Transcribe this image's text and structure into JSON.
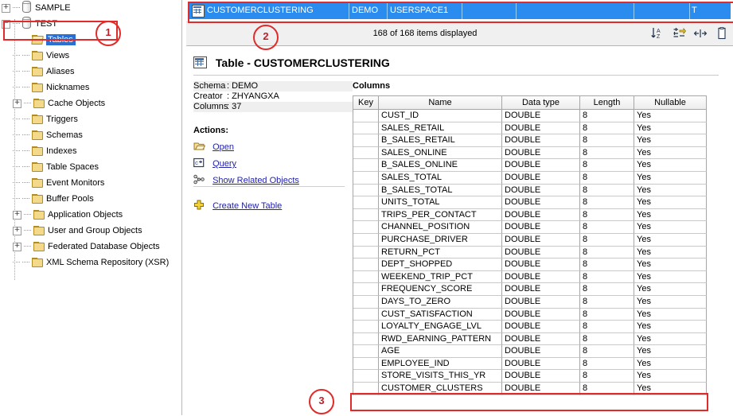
{
  "tree": {
    "items": [
      {
        "label": "SAMPLE",
        "icon": "database-icon",
        "level": 0,
        "expander": "plus",
        "selected": false
      },
      {
        "label": "TEST",
        "icon": "database-icon",
        "level": 0,
        "expander": "minus",
        "selected": false
      },
      {
        "label": "Tables",
        "icon": "folder-open-icon",
        "level": 1,
        "expander": "none",
        "selected": true
      },
      {
        "label": "Views",
        "icon": "folder-icon",
        "level": 1,
        "expander": "none",
        "selected": false
      },
      {
        "label": "Aliases",
        "icon": "folder-icon",
        "level": 1,
        "expander": "none",
        "selected": false
      },
      {
        "label": "Nicknames",
        "icon": "folder-icon",
        "level": 1,
        "expander": "none",
        "selected": false
      },
      {
        "label": "Cache Objects",
        "icon": "folder-icon",
        "level": 1,
        "expander": "plus",
        "selected": false
      },
      {
        "label": "Triggers",
        "icon": "folder-icon",
        "level": 1,
        "expander": "none",
        "selected": false
      },
      {
        "label": "Schemas",
        "icon": "folder-icon",
        "level": 1,
        "expander": "none",
        "selected": false
      },
      {
        "label": "Indexes",
        "icon": "folder-icon",
        "level": 1,
        "expander": "none",
        "selected": false
      },
      {
        "label": "Table Spaces",
        "icon": "folder-icon",
        "level": 1,
        "expander": "none",
        "selected": false
      },
      {
        "label": "Event Monitors",
        "icon": "folder-icon",
        "level": 1,
        "expander": "none",
        "selected": false
      },
      {
        "label": "Buffer Pools",
        "icon": "folder-icon",
        "level": 1,
        "expander": "none",
        "selected": false
      },
      {
        "label": "Application Objects",
        "icon": "folder-icon",
        "level": 1,
        "expander": "plus",
        "selected": false
      },
      {
        "label": "User and Group Objects",
        "icon": "folder-icon",
        "level": 1,
        "expander": "plus",
        "selected": false
      },
      {
        "label": "Federated Database Objects",
        "icon": "folder-icon",
        "level": 1,
        "expander": "plus",
        "selected": false
      },
      {
        "label": "XML Schema Repository (XSR)",
        "icon": "folder-icon",
        "level": 1,
        "expander": "none",
        "selected": false
      }
    ]
  },
  "object_list": {
    "selected_row": {
      "name": "CUSTOMERCLUSTERING",
      "schema": "DEMO",
      "table_space": "USERSPACE1",
      "col4": "",
      "col5": "",
      "col6": "",
      "col7": "T"
    },
    "status": "168 of 168 items displayed",
    "toolbar": [
      {
        "name": "sort-icon",
        "label": "Sort"
      },
      {
        "name": "filter-icon",
        "label": "Filter"
      },
      {
        "name": "fit-columns-icon",
        "label": "Fit columns"
      },
      {
        "name": "copy-icon",
        "label": "Copy"
      }
    ]
  },
  "detail": {
    "title": "Table - CUSTOMERCLUSTERING",
    "info": [
      {
        "key": "Schema",
        "value": ": DEMO"
      },
      {
        "key": "Creator",
        "value": ": ZHYANGXA"
      },
      {
        "key": "Columns",
        "value": ": 37"
      }
    ],
    "actions_header": "Actions:",
    "actions": [
      {
        "label": "Open",
        "icon": "folder-open-icon"
      },
      {
        "label": "Query",
        "icon": "query-icon"
      },
      {
        "label": "Show Related Objects",
        "icon": "related-objects-icon"
      },
      {
        "label": "Create New Table",
        "icon": "plus-icon"
      }
    ],
    "columns_header": "Columns",
    "grid_headers": [
      "Key",
      "Name",
      "Data type",
      "Length",
      "Nullable"
    ],
    "rows": [
      {
        "key": "",
        "name": "CUST_ID",
        "type": "DOUBLE",
        "length": "8",
        "nullable": "Yes"
      },
      {
        "key": "",
        "name": "SALES_RETAIL",
        "type": "DOUBLE",
        "length": "8",
        "nullable": "Yes"
      },
      {
        "key": "",
        "name": "B_SALES_RETAIL",
        "type": "DOUBLE",
        "length": "8",
        "nullable": "Yes"
      },
      {
        "key": "",
        "name": "SALES_ONLINE",
        "type": "DOUBLE",
        "length": "8",
        "nullable": "Yes"
      },
      {
        "key": "",
        "name": "B_SALES_ONLINE",
        "type": "DOUBLE",
        "length": "8",
        "nullable": "Yes"
      },
      {
        "key": "",
        "name": "SALES_TOTAL",
        "type": "DOUBLE",
        "length": "8",
        "nullable": "Yes"
      },
      {
        "key": "",
        "name": "B_SALES_TOTAL",
        "type": "DOUBLE",
        "length": "8",
        "nullable": "Yes"
      },
      {
        "key": "",
        "name": "UNITS_TOTAL",
        "type": "DOUBLE",
        "length": "8",
        "nullable": "Yes"
      },
      {
        "key": "",
        "name": "TRIPS_PER_CONTACT",
        "type": "DOUBLE",
        "length": "8",
        "nullable": "Yes"
      },
      {
        "key": "",
        "name": "CHANNEL_POSITION",
        "type": "DOUBLE",
        "length": "8",
        "nullable": "Yes"
      },
      {
        "key": "",
        "name": "PURCHASE_DRIVER",
        "type": "DOUBLE",
        "length": "8",
        "nullable": "Yes"
      },
      {
        "key": "",
        "name": "RETURN_PCT",
        "type": "DOUBLE",
        "length": "8",
        "nullable": "Yes"
      },
      {
        "key": "",
        "name": "DEPT_SHOPPED",
        "type": "DOUBLE",
        "length": "8",
        "nullable": "Yes"
      },
      {
        "key": "",
        "name": "WEEKEND_TRIP_PCT",
        "type": "DOUBLE",
        "length": "8",
        "nullable": "Yes"
      },
      {
        "key": "",
        "name": "FREQUENCY_SCORE",
        "type": "DOUBLE",
        "length": "8",
        "nullable": "Yes"
      },
      {
        "key": "",
        "name": "DAYS_TO_ZERO",
        "type": "DOUBLE",
        "length": "8",
        "nullable": "Yes"
      },
      {
        "key": "",
        "name": "CUST_SATISFACTION",
        "type": "DOUBLE",
        "length": "8",
        "nullable": "Yes"
      },
      {
        "key": "",
        "name": "LOYALTY_ENGAGE_LVL",
        "type": "DOUBLE",
        "length": "8",
        "nullable": "Yes"
      },
      {
        "key": "",
        "name": "RWD_EARNING_PATTERN",
        "type": "DOUBLE",
        "length": "8",
        "nullable": "Yes"
      },
      {
        "key": "",
        "name": "AGE",
        "type": "DOUBLE",
        "length": "8",
        "nullable": "Yes"
      },
      {
        "key": "",
        "name": "EMPLOYEE_IND",
        "type": "DOUBLE",
        "length": "8",
        "nullable": "Yes"
      },
      {
        "key": "",
        "name": "STORE_VISITS_THIS_YR",
        "type": "DOUBLE",
        "length": "8",
        "nullable": "Yes"
      },
      {
        "key": "",
        "name": "CUSTOMER_CLUSTERS",
        "type": "DOUBLE",
        "length": "8",
        "nullable": "Yes"
      }
    ]
  },
  "annotations": {
    "markers": [
      {
        "label": "1"
      },
      {
        "label": "2"
      },
      {
        "label": "3"
      }
    ],
    "color": "#e02b2b"
  }
}
